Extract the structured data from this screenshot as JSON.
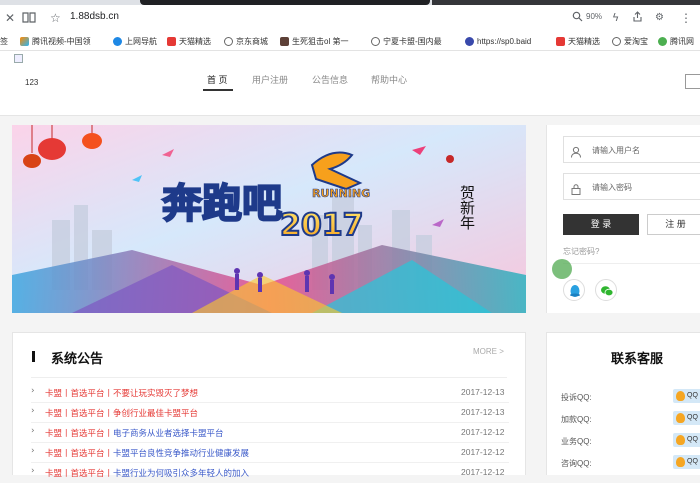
{
  "browser": {
    "url": "1.88dsb.cn",
    "zoom": "90%",
    "bookmarks": [
      {
        "label": "签",
        "icon": "none"
      },
      {
        "label": "腾讯视频-中国领",
        "icon": "tencent-video-icon"
      },
      {
        "label": "上网导航",
        "icon": "ie-icon"
      },
      {
        "label": "天猫精选",
        "icon": "tmall-icon"
      },
      {
        "label": "京东商城",
        "icon": "globe-icon"
      },
      {
        "label": "生死狙击ol 第一",
        "icon": "game-icon"
      },
      {
        "label": "宁夏卡盟-国内最",
        "icon": "globe-icon"
      },
      {
        "label": "https://sp0.baid",
        "icon": "paw-icon"
      },
      {
        "label": "天猫精选",
        "icon": "tmall-icon"
      },
      {
        "label": "爱淘宝",
        "icon": "globe-icon"
      },
      {
        "label": "腾讯网",
        "icon": "tencent-icon"
      }
    ]
  },
  "header": {
    "logo_text": "123",
    "nav": [
      "首 页",
      "用户注册",
      "公告信息",
      "帮助中心"
    ]
  },
  "banner": {
    "headline": "奔跑吧",
    "subtitle": "RUNNING",
    "year": "2017",
    "greeting": "贺新年"
  },
  "login": {
    "username_placeholder": "请输入用户名",
    "password_placeholder": "请输入密码",
    "login_label": "登 录",
    "register_label": "注 册",
    "forgot_label": "忘记密码?"
  },
  "announcements": {
    "title": "系统公告",
    "more_label": "MORE >",
    "items": [
      {
        "prefix": "卡盟丨首选平台丨",
        "text": "不要让玩实毁灭了梦想",
        "date": "2017-12-13"
      },
      {
        "prefix": "卡盟丨首选平台丨",
        "text": "争创行业最佳卡盟平台",
        "date": "2017-12-13"
      },
      {
        "prefix": "卡盟丨首选平台丨",
        "text": "电子商务从业者选择卡盟平台",
        "date": "2017-12-12"
      },
      {
        "prefix": "卡盟丨首选平台丨",
        "text": "卡盟平台良性竞争推动行业健康发展",
        "date": "2017-12-12"
      },
      {
        "prefix": "卡盟丨首选平台丨",
        "text": "卡盟行业为何吸引众多年轻人的加入",
        "date": "2017-12-12"
      }
    ]
  },
  "contact": {
    "title": "联系客服",
    "rows": [
      {
        "label": "投诉QQ:",
        "badge": "QQ"
      },
      {
        "label": "加款QQ:",
        "badge": "QQ"
      },
      {
        "label": "业务QQ:",
        "badge": "QQ"
      },
      {
        "label": "咨询QQ:",
        "badge": "QQ"
      }
    ]
  },
  "colors": {
    "accent_dark": "#333333",
    "announce_prefix": "#e53935",
    "announce_text": "#3b5ac9"
  }
}
